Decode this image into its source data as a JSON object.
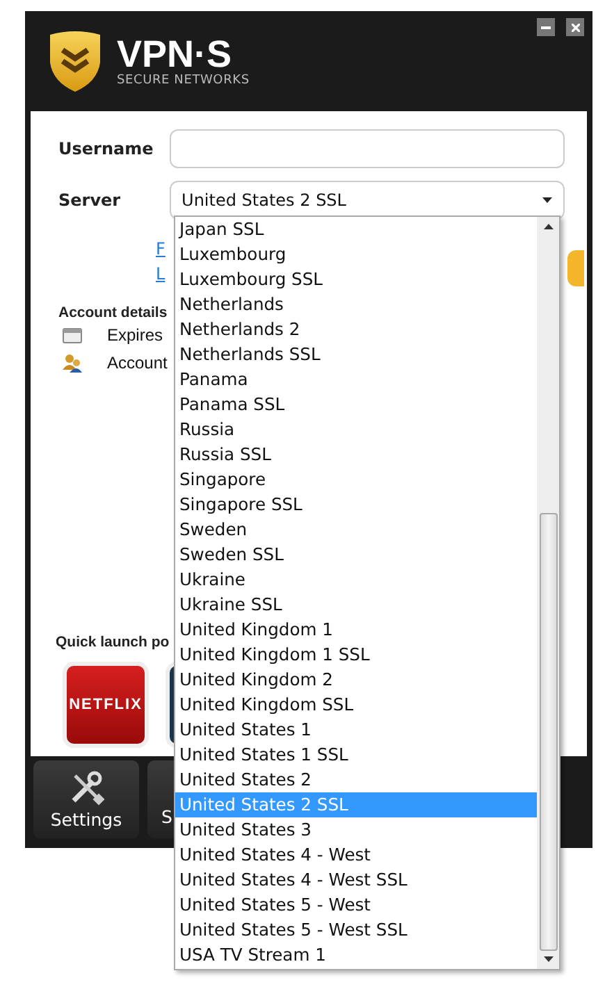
{
  "header": {
    "logo_title": "VPN·S",
    "logo_subtitle": "SECURE NETWORKS"
  },
  "username": {
    "label": "Username"
  },
  "server": {
    "label": "Server",
    "value": "United States 2 SSL"
  },
  "links": [
    "F",
    "L"
  ],
  "account": {
    "heading": "Account details",
    "rows": [
      {
        "kind": "calendar",
        "label": "Expires"
      },
      {
        "kind": "users",
        "label": "Account"
      }
    ]
  },
  "quick_launch": {
    "heading": "Quick launch po",
    "tiles": [
      {
        "kind": "netflix",
        "label": "NETFLIX"
      },
      {
        "kind": "dark"
      }
    ]
  },
  "toolbar": [
    {
      "kind": "tools",
      "label": "Settings"
    },
    {
      "kind": "plain",
      "label": "S"
    }
  ],
  "dropdown": {
    "options": [
      {
        "label": "Japan SSL",
        "selected": false
      },
      {
        "label": "Luxembourg",
        "selected": false
      },
      {
        "label": "Luxembourg SSL",
        "selected": false
      },
      {
        "label": "Netherlands",
        "selected": false
      },
      {
        "label": "Netherlands 2",
        "selected": false
      },
      {
        "label": "Netherlands SSL",
        "selected": false
      },
      {
        "label": "Panama",
        "selected": false
      },
      {
        "label": "Panama SSL",
        "selected": false
      },
      {
        "label": "Russia",
        "selected": false
      },
      {
        "label": "Russia SSL",
        "selected": false
      },
      {
        "label": "Singapore",
        "selected": false
      },
      {
        "label": "Singapore SSL",
        "selected": false
      },
      {
        "label": "Sweden",
        "selected": false
      },
      {
        "label": "Sweden SSL",
        "selected": false
      },
      {
        "label": "Ukraine",
        "selected": false
      },
      {
        "label": "Ukraine SSL",
        "selected": false
      },
      {
        "label": "United Kingdom 1",
        "selected": false
      },
      {
        "label": "United Kingdom 1 SSL",
        "selected": false
      },
      {
        "label": "United Kingdom 2",
        "selected": false
      },
      {
        "label": "United Kingdom SSL",
        "selected": false
      },
      {
        "label": "United States 1",
        "selected": false
      },
      {
        "label": "United States 1 SSL",
        "selected": false
      },
      {
        "label": "United States 2",
        "selected": false
      },
      {
        "label": "United States 2 SSL",
        "selected": true
      },
      {
        "label": "United States 3",
        "selected": false
      },
      {
        "label": "United States 4 - West",
        "selected": false
      },
      {
        "label": "United States 4 - West SSL",
        "selected": false
      },
      {
        "label": "United States 5 - West",
        "selected": false
      },
      {
        "label": "United States 5 - West SSL",
        "selected": false
      },
      {
        "label": "USA TV Stream 1",
        "selected": false
      }
    ]
  }
}
